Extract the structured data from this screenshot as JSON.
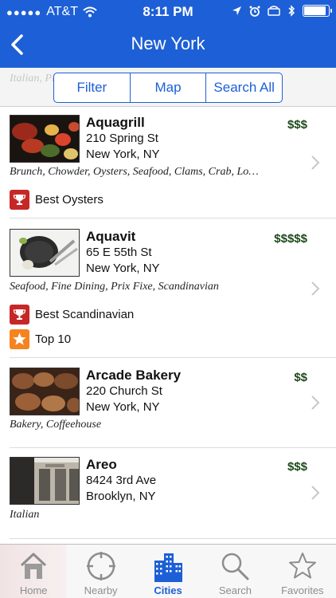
{
  "status": {
    "carrier": "AT&T",
    "time": "8:11 PM",
    "battery_level": 0.9
  },
  "nav": {
    "title": "New York",
    "back_icon": "chevron-left-icon"
  },
  "segmented": {
    "ghost_text": "Italian, Pizza",
    "items": [
      "Filter",
      "Map",
      "Search All"
    ]
  },
  "restaurants": [
    {
      "name": "Aquagrill",
      "street": "210 Spring St",
      "city": "New York, NY",
      "price": "$$$",
      "tags": "Brunch, Chowder, Oysters, Seafood, Clams, Crab, Lo…",
      "awards": [
        {
          "label": "Best Oysters",
          "icon": "trophy-icon"
        }
      ]
    },
    {
      "name": "Aquavit",
      "street": "65 E 55th St",
      "city": "New York, NY",
      "price": "$$$$$",
      "tags": "Seafood, Fine Dining, Prix Fixe, Scandinavian",
      "awards": [
        {
          "label": "Best Scandinavian",
          "icon": "trophy-icon"
        },
        {
          "label": "Top 10",
          "icon": "star-icon"
        }
      ]
    },
    {
      "name": "Arcade Bakery",
      "street": "220 Church St",
      "city": "New York, NY",
      "price": "$$",
      "tags": "Bakery, Coffeehouse",
      "awards": []
    },
    {
      "name": "Areo",
      "street": "8424 3rd Ave",
      "city": "Brooklyn, NY",
      "price": "$$$",
      "tags": "Italian",
      "awards": []
    }
  ],
  "tabs": [
    {
      "label": "Home",
      "icon": "home-icon"
    },
    {
      "label": "Nearby",
      "icon": "crosshair-icon"
    },
    {
      "label": "Cities",
      "icon": "buildings-icon"
    },
    {
      "label": "Search",
      "icon": "search-icon"
    },
    {
      "label": "Favorites",
      "icon": "star-outline-icon"
    }
  ],
  "colors": {
    "brand_blue": "#1d5fd6",
    "price_green": "#1d4a1a",
    "award_red": "#c62828",
    "award_orange": "#f5831f"
  }
}
